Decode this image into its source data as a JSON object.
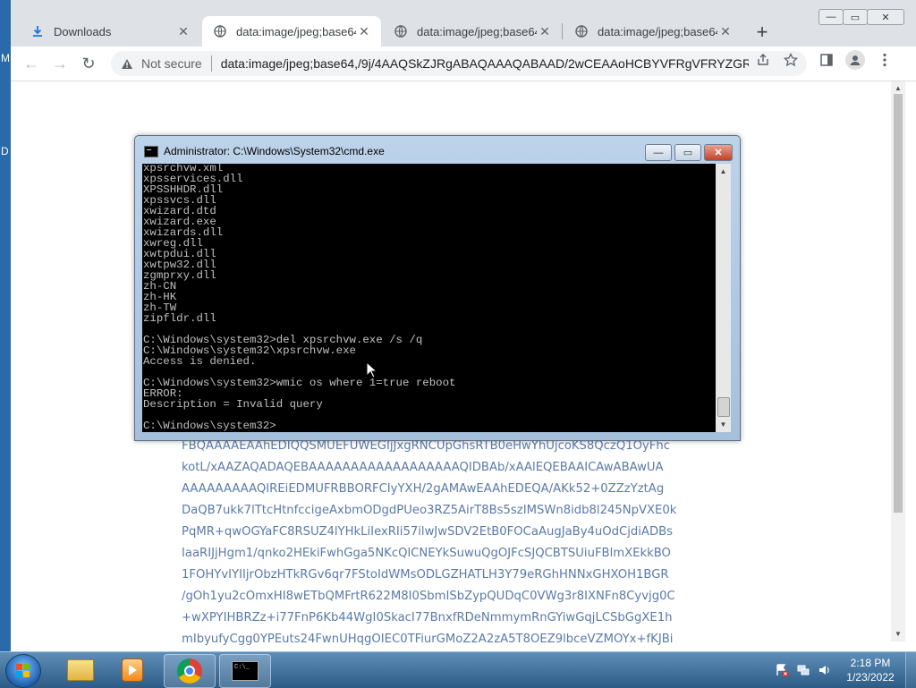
{
  "desktop": {
    "edge_letters": [
      "M",
      "D"
    ]
  },
  "browser": {
    "tabs": [
      {
        "title": "Downloads",
        "icon": "download-icon",
        "active": false
      },
      {
        "title": "data:image/jpeg;base64,/",
        "icon": "globe-icon",
        "active": true
      },
      {
        "title": "data:image/jpeg;base64,/",
        "icon": "globe-icon",
        "active": false
      },
      {
        "title": "data:image/jpeg;base64,/",
        "icon": "globe-icon",
        "active": false
      }
    ],
    "new_tab_symbol": "+",
    "window_controls": {
      "minimize": "—",
      "maximize": "▭",
      "close": "✕"
    },
    "toolbar": {
      "back": "←",
      "forward": "→",
      "reload": "↻",
      "security_label": "Not secure",
      "url": "data:image/jpeg;base64,/9j/4AAQSkZJRgABAQAAAQABAAD/2wCEAAoHCBYVFRgVFRYZGRgZ...",
      "share_icon": "share-icon",
      "bookmark_icon": "star-icon",
      "sidepanel_icon": "side-panel-icon",
      "profile_icon": "profile-icon",
      "menu_icon": "kebab-menu-icon"
    },
    "page_base64_lines": [
      "FBQAAAAEAAhEDIQQSMUEFUWEGIjJxgRNCUpGhsRTB0eHwYhUjcoKS8QczQ1OyFhc",
      "kotL/xAAZAQADAQEBAAAAAAAAAAAAAAAAAAQIDBAb/xAAlEQEBAAICAwABAwUA",
      "AAAAAAAAAQIREiEDMUFRBBORFCIyYXH/2gAMAwEAAhEDEQA/AKk52+0ZZzYztAg",
      "DaQB7ukk7lTtcHtnfccigeAxbmODgdPUeo3RZ5AirT8Bs5szIMSWn8idb8l245NpVXE0k",
      "PqMR+qwOGYaFC8RSUZ4lYHkLiIexRIi57ilwJwSDV2EtB0FOCaAugJaBy4uOdCjdiADBs",
      "IaaRIJjHgm1/qnko2HEkiFwhGga5NKcQlCNEYkSuwuQgOJFcSJQCBTSUiuFBlmXEkkBO",
      "1FOHYvIYIIjrObzHTkRGv6qr7FStoIdWMsODLGZHATLH3Y79eRGhHNNxGHXOH1BGR",
      "/gOh1yu2cOmxHI8wETbQMFrtR622M8I0SbmISbZypQUDqC0VWg3r8IXNFn8Cyvjg0C",
      "+wXPYIHBRZz+i77FnP6Kb44WgI0SkacI77BnxfRDeNmmymRnGYiwGqjLCSbGgXE1h",
      "mIbyufyCgg0YPEuts24FwnUHqgOIEC0TFiurGMoZ2A2zA5T8OEZ9lbceVZMOYx+fKJBi"
    ]
  },
  "cmd": {
    "title": "Administrator: C:\\Windows\\System32\\cmd.exe",
    "buttons": {
      "minimize": "—",
      "maximize": "▭",
      "close": "✕"
    },
    "lines": [
      "xpsrchvw.xml",
      "xpsservices.dll",
      "XPSSHHDR.dll",
      "xpssvcs.dll",
      "xwizard.dtd",
      "xwizard.exe",
      "xwizards.dll",
      "xwreg.dll",
      "xwtpdui.dll",
      "xwtpw32.dll",
      "zgmprxy.dll",
      "zh-CN",
      "zh-HK",
      "zh-TW",
      "zipfldr.dll",
      "",
      "C:\\Windows\\system32>del xpsrchvw.exe /s /q",
      "C:\\Windows\\system32\\xpsrchvw.exe",
      "Access is denied.",
      "",
      "C:\\Windows\\system32>wmic os where 1=true reboot",
      "ERROR:",
      "Description = Invalid query",
      "",
      "C:\\Windows\\system32>"
    ]
  },
  "taskbar": {
    "apps": [
      "start-button",
      "file-explorer",
      "media-player",
      "chrome",
      "cmd"
    ],
    "tray_icons": [
      "flag-alert-icon",
      "network-icon",
      "volume-icon"
    ],
    "time": "2:18 PM",
    "date": "1/23/2022"
  }
}
